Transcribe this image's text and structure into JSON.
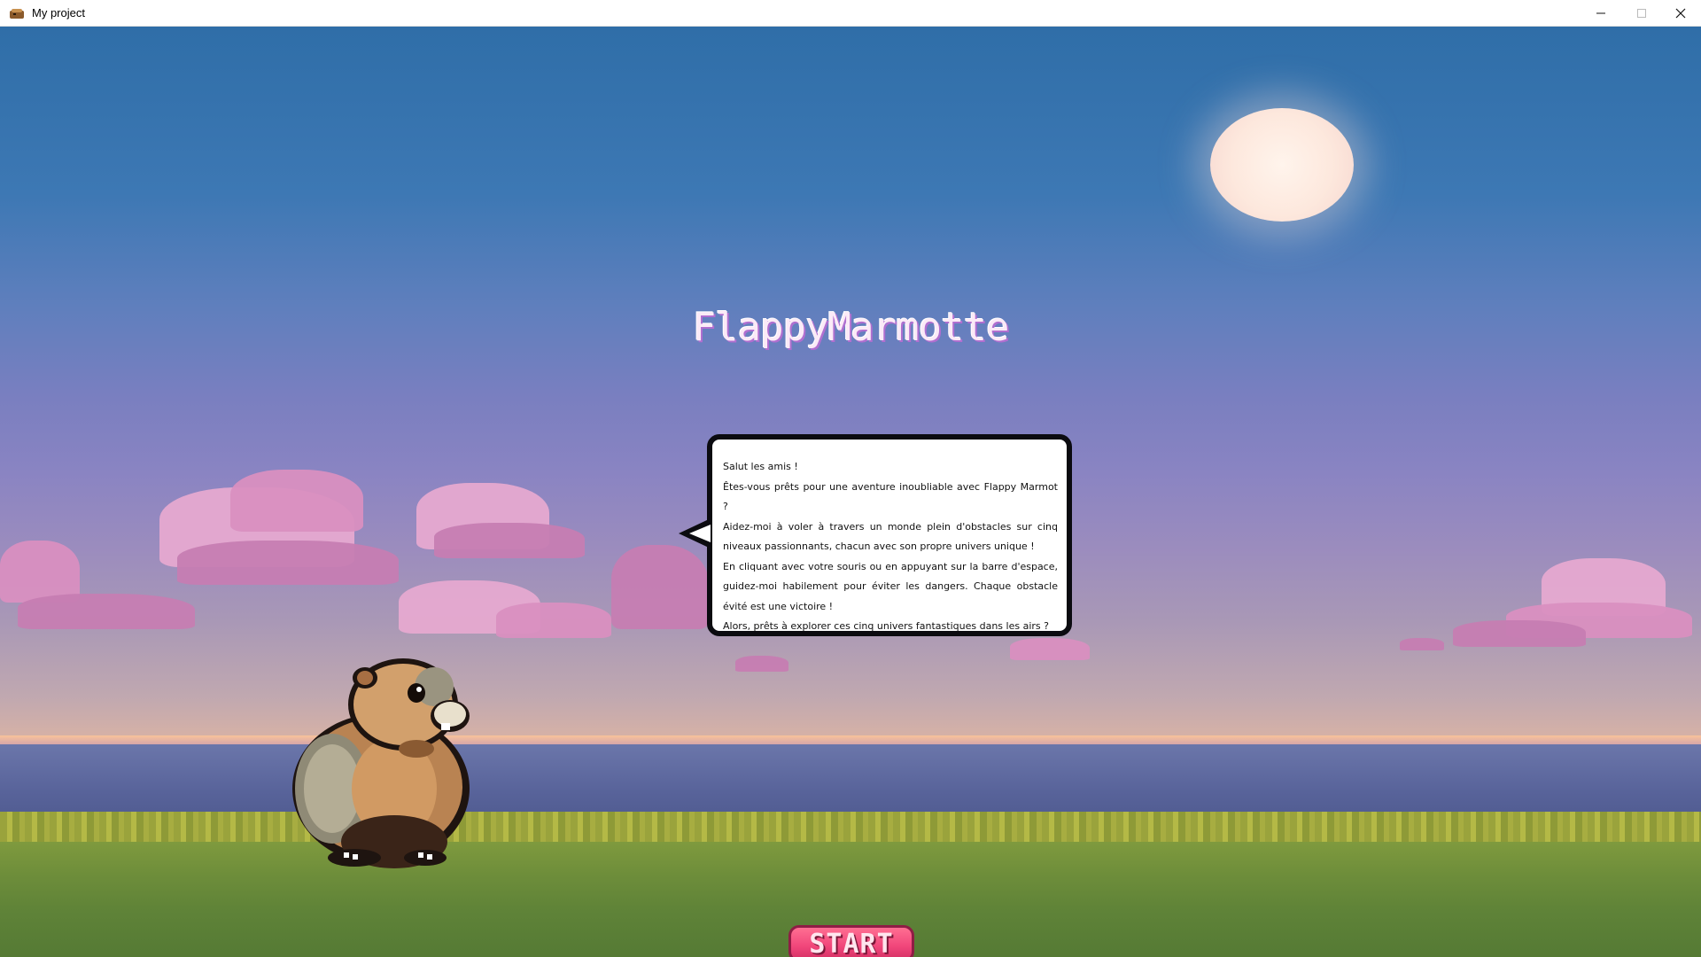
{
  "window": {
    "title": "My project",
    "icon": "app-icon",
    "controls": {
      "minimize": "–",
      "maximize": "□",
      "close": "✕"
    }
  },
  "game": {
    "title": "FlappyMarmotte",
    "dialog": {
      "lines": [
        "Salut les amis !",
        "Êtes-vous prêts pour une aventure inoubliable avec Flappy Marmot ?",
        "Aidez-moi à voler à travers un monde plein d'obstacles sur cinq niveaux passionnants, chacun avec son propre univers unique !",
        "En cliquant avec votre souris ou en appuyant sur la barre d'espace, guidez-moi habilement pour éviter les dangers. Chaque obstacle évité est une victoire !",
        "Alors, prêts à explorer ces cinq univers fantastiques dans les airs ?"
      ]
    },
    "start_label": "START"
  },
  "colors": {
    "sky_top": "#2f6ea8",
    "sky_mid": "#8a84c2",
    "horizon": "#f1c197",
    "cloud": "#d98fc0",
    "grass": "#6d8d3a",
    "start_button": "#f0457a",
    "title_text": "#fbeaf7",
    "title_shadow": "#b06fd0"
  }
}
